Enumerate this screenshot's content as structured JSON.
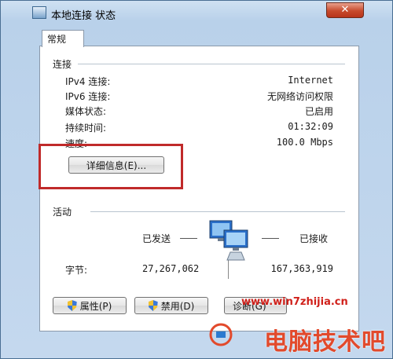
{
  "window": {
    "title": "本地连接 状态",
    "close_label": "✕"
  },
  "tabs": [
    {
      "label": "常规"
    }
  ],
  "connection": {
    "section_label": "连接",
    "rows": [
      {
        "label": "IPv4 连接:",
        "value": "Internet"
      },
      {
        "label": "IPv6 连接:",
        "value": "无网络访问权限"
      },
      {
        "label": "媒体状态:",
        "value": "已启用"
      },
      {
        "label": "持续时间:",
        "value": "01:32:09"
      },
      {
        "label": "速度:",
        "value": "100.0 Mbps"
      }
    ],
    "details_button": "详细信息(E)..."
  },
  "activity": {
    "section_label": "活动",
    "sent_label": "已发送",
    "received_label": "已接收",
    "bytes_label": "字节:",
    "bytes_sent": "27,267,062",
    "bytes_received": "167,363,919"
  },
  "buttons": {
    "properties": "属性(P)",
    "disable": "禁用(D)",
    "diagnose": "诊断(G)"
  },
  "watermark": {
    "url": "www.win7zhijia.cn",
    "text": "电脑技术吧"
  },
  "colors": {
    "highlight_border": "#c02a2a",
    "close_button": "#c74a2c"
  }
}
